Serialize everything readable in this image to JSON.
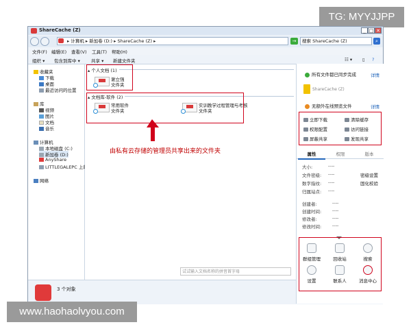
{
  "watermarks": {
    "top": "TG: MYYJJPP",
    "bottom": "www.haohaolvyou.com"
  },
  "window": {
    "title": "ShareCache (Z)",
    "controls": {
      "minimize": "_",
      "maximize": "□",
      "close": "✕"
    }
  },
  "address": {
    "path": "▸ 计算机 ▸ 新加卷 (D:) ▸ ShareCache (Z) ▸",
    "search_placeholder": "搜索 ShareCache (Z)"
  },
  "menu": [
    "文件(F)",
    "编辑(E)",
    "查看(V)",
    "工具(T)",
    "帮助(H)"
  ],
  "toolbar": [
    "组织 ▾",
    "包含到库中 ▾",
    "共享 ▾",
    "新建文件夹"
  ],
  "nav": {
    "favorites": "收藏夹",
    "downloads": "下载",
    "desktop": "桌面",
    "recent": "最近访问的位置",
    "library": "库",
    "videos": "视频",
    "pictures": "图片",
    "documents": "文档",
    "music": "音乐",
    "computer": "计算机",
    "local_c": "本地磁盘 (C:)",
    "new_d": "新加卷 (D:)",
    "anyshare": "AnyShare",
    "littlegale": "LITTLEGALEPC 上的",
    "network": "网络"
  },
  "content": {
    "group1": "▴ 个人文档 (1)",
    "group1_items": [
      {
        "line1": "谢立强",
        "line2": "文件夹"
      }
    ],
    "group2": "▴ 文档库-软件 (2)",
    "group2_items": [
      {
        "line1": "常用软件",
        "line2": "文件夹"
      },
      {
        "line1": "实训教学过程管理与考核",
        "line2": "文件夹"
      }
    ],
    "annotation": "由私有云存储的管理员共享出来的文件夹",
    "bottom_search": "试试输入文档名称的拼音首字母"
  },
  "right_panel": {
    "sync_status": "所有文件都已同步完成",
    "details": "详情",
    "folder_name": "ShareCache (Z)",
    "offline_status": "无额外在线预览文件",
    "actions": [
      {
        "label": "立即下载",
        "icon": "download-icon"
      },
      {
        "label": "清除缓存",
        "icon": "trash-icon"
      },
      {
        "label": "权限配置",
        "icon": "share-icon"
      },
      {
        "label": "访问链接",
        "icon": "link-icon"
      },
      {
        "label": "屏蔽共享",
        "icon": "block-icon"
      },
      {
        "label": "发现共享",
        "icon": "discover-icon"
      }
    ],
    "tabs": [
      "属性",
      "权限",
      "版本"
    ],
    "props": [
      {
        "label": "大小:",
        "value": "----"
      },
      {
        "label": "文件密级:",
        "value": "----",
        "extra": "密级设置"
      },
      {
        "label": "数字指纹:",
        "value": "----",
        "extra": "固化校验"
      },
      {
        "label": "归属站点:",
        "value": "----"
      },
      {
        "label": "创建者:",
        "value": "----"
      },
      {
        "label": "创建时间:",
        "value": "----"
      },
      {
        "label": "修改者:",
        "value": "----"
      },
      {
        "label": "修改时间:",
        "value": "----"
      }
    ],
    "grid": [
      {
        "label": "群组管理",
        "icon": "group-icon"
      },
      {
        "label": "回收站",
        "icon": "recycle-icon"
      },
      {
        "label": "搜索",
        "icon": "search-icon"
      },
      {
        "label": "设置",
        "icon": "gear-icon"
      },
      {
        "label": "联系人",
        "icon": "contact-icon"
      },
      {
        "label": "消息中心",
        "icon": "message-icon"
      }
    ]
  },
  "status": {
    "count": "3 个对象"
  },
  "colors": {
    "accent_red": "#d0021b",
    "brand_red": "#e03a3a",
    "link_blue": "#2266bb"
  }
}
